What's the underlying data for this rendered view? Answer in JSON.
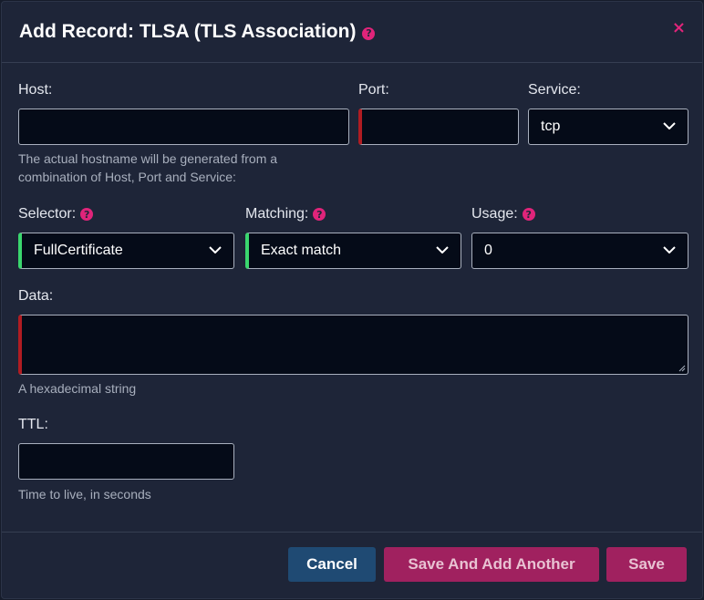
{
  "dialog": {
    "title": "Add Record: TLSA (TLS Association)",
    "close_symbol": "×"
  },
  "fields": {
    "host": {
      "label": "Host:",
      "value": ""
    },
    "port": {
      "label": "Port:",
      "value": ""
    },
    "service": {
      "label": "Service:",
      "value": "tcp"
    },
    "host_help": "The actual hostname will be generated from a combination of Host, Port and Service:",
    "selector": {
      "label": "Selector:",
      "value": "FullCertificate"
    },
    "matching": {
      "label": "Matching:",
      "value": "Exact match"
    },
    "usage": {
      "label": "Usage:",
      "value": "0"
    },
    "data": {
      "label": "Data:",
      "value": "",
      "help": "A hexadecimal string"
    },
    "ttl": {
      "label": "TTL:",
      "value": "",
      "help": "Time to live, in seconds"
    }
  },
  "help_icon_glyph": "?",
  "footer": {
    "cancel": "Cancel",
    "save_and_add": "Save And Add Another",
    "save": "Save"
  },
  "icons": [
    "help-icon",
    "close-icon",
    "chevron-down-icon"
  ],
  "colors": {
    "accent": "#e0247a",
    "invalid": "#b01c22",
    "valid": "#3ad66e",
    "primary_button": "#a0215f",
    "cancel_button": "#1f4a73"
  }
}
